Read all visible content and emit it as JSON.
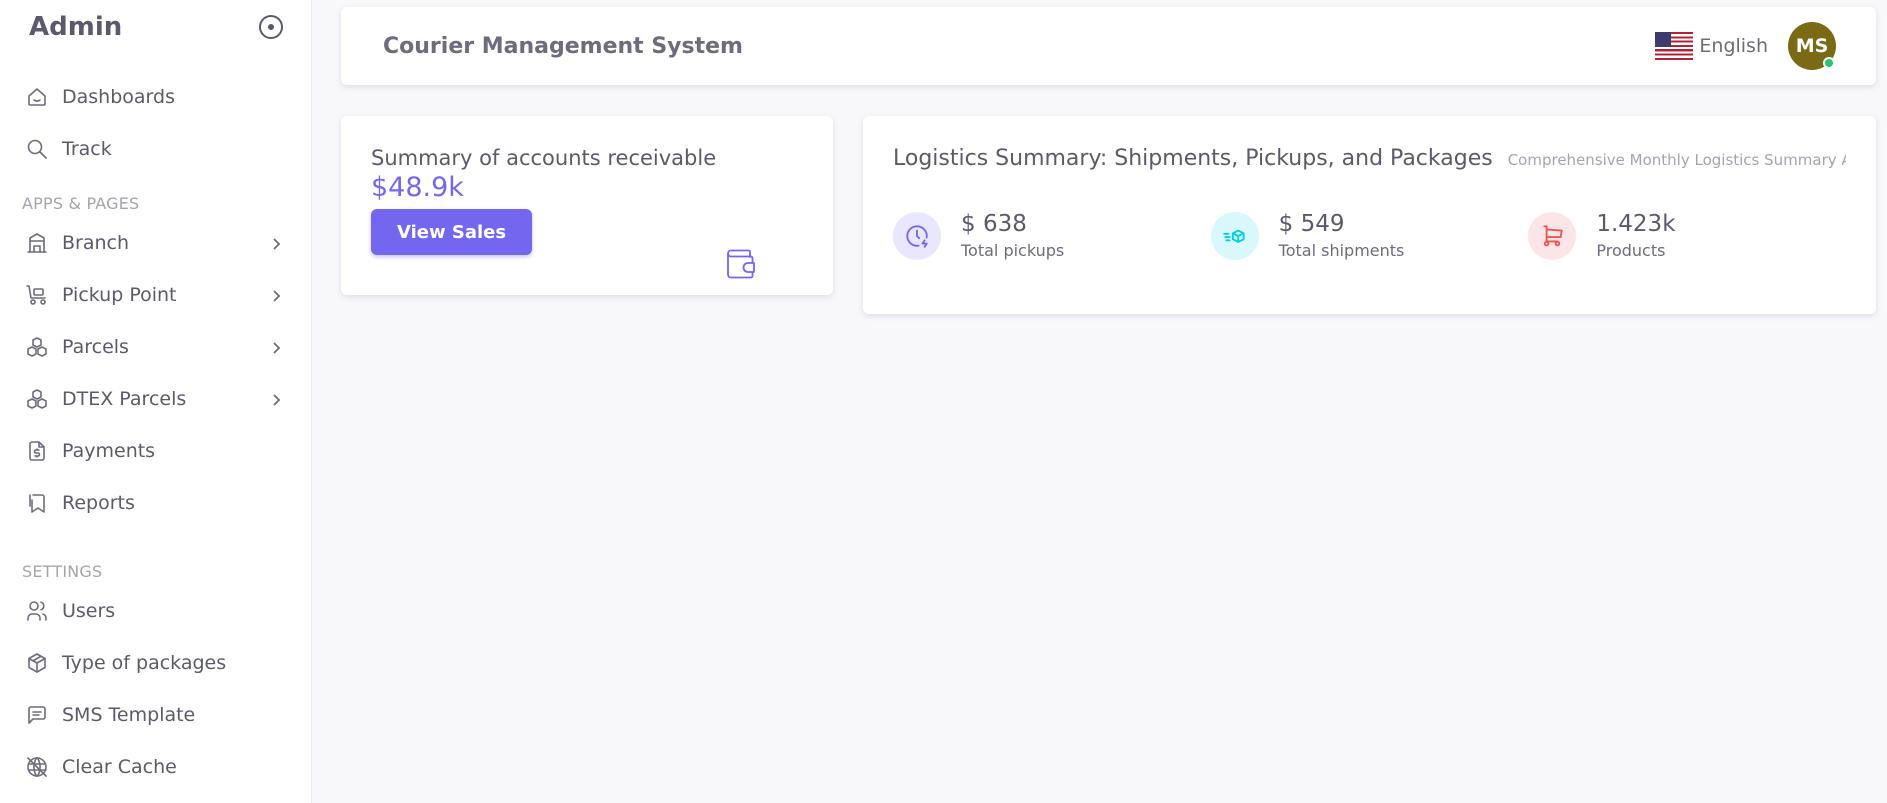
{
  "sidebar": {
    "brand": "Admin",
    "top_items": [
      {
        "label": "Dashboards",
        "icon": "home-icon"
      },
      {
        "label": "Track",
        "icon": "search-icon"
      }
    ],
    "apps_header": "APPS & PAGES",
    "apps_items": [
      {
        "label": "Branch",
        "icon": "building-icon"
      },
      {
        "label": "Pickup Point",
        "icon": "truck-loading-icon"
      },
      {
        "label": "Parcels",
        "icon": "boxes-icon"
      },
      {
        "label": "DTEX Parcels",
        "icon": "boxes-icon"
      },
      {
        "label": "Payments",
        "icon": "invoice-icon"
      },
      {
        "label": "Reports",
        "icon": "bookmark-icon"
      }
    ],
    "settings_header": "SETTINGS",
    "settings_items": [
      {
        "label": "Users",
        "icon": "users-icon"
      },
      {
        "label": "Type of packages",
        "icon": "package-icon"
      },
      {
        "label": "SMS Template",
        "icon": "message-icon"
      },
      {
        "label": "Clear Cache",
        "icon": "world-off-icon"
      }
    ]
  },
  "navbar": {
    "title": "Courier Management System",
    "language": "English",
    "avatar_initials": "MS",
    "avatar_color": "#7a6a16"
  },
  "accounts": {
    "title": "Summary of accounts receivable",
    "amount": "$48.9k",
    "button": "View Sales"
  },
  "logistics": {
    "title": "Logistics Summary: Shipments, Pickups, and Packages",
    "subtitle": "Comprehensive Monthly Logistics Summary Apr",
    "stats": [
      {
        "value": "$ 638",
        "label": "Total pickups",
        "icon": "clock-bolt-icon",
        "color": "#7367f0",
        "bg": "#e9e7fd"
      },
      {
        "value": "$ 549",
        "label": "Total shipments",
        "icon": "fast-box-icon",
        "color": "#00cfe8",
        "bg": "#d9f8fc"
      },
      {
        "value": "1.423k",
        "label": "Products",
        "icon": "cart-icon",
        "color": "#ea5455",
        "bg": "#fce5e6"
      }
    ]
  },
  "colors": {
    "primary": "#7367f0",
    "background": "#f8f7fa",
    "online": "#28c76f"
  }
}
